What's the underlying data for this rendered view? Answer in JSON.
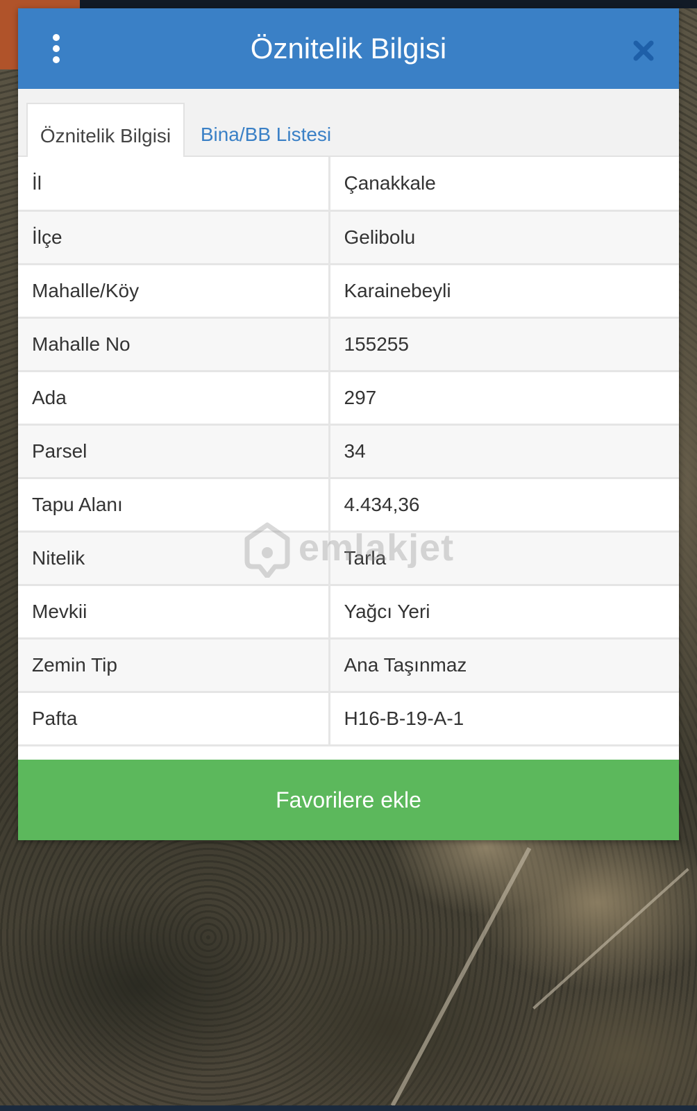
{
  "header": {
    "title": "Öznitelik Bilgisi"
  },
  "tabs": [
    {
      "label": "Öznitelik Bilgisi",
      "active": true
    },
    {
      "label": "Bina/BB Listesi",
      "active": false
    }
  ],
  "attributes": [
    {
      "key": "İl",
      "value": "Çanakkale"
    },
    {
      "key": "İlçe",
      "value": "Gelibolu"
    },
    {
      "key": "Mahalle/Köy",
      "value": "Karainebeyli"
    },
    {
      "key": "Mahalle No",
      "value": "155255"
    },
    {
      "key": "Ada",
      "value": "297"
    },
    {
      "key": "Parsel",
      "value": "34"
    },
    {
      "key": "Tapu Alanı",
      "value": "4.434,36"
    },
    {
      "key": "Nitelik",
      "value": "Tarla"
    },
    {
      "key": "Mevkii",
      "value": "Yağcı Yeri"
    },
    {
      "key": "Zemin Tip",
      "value": "Ana Taşınmaz"
    },
    {
      "key": "Pafta",
      "value": "H16-B-19-A-1"
    }
  ],
  "watermark": {
    "text": "emlakjet"
  },
  "footer": {
    "favorite_label": "Favorilere ekle"
  },
  "colors": {
    "header": "#3a80c6",
    "tab_link": "#3a80c6",
    "favorite_button": "#5cb85c",
    "close_icon": "#1e5fa8"
  },
  "icons": {
    "menu": "vertical-ellipsis-icon",
    "close": "close-icon",
    "watermark_logo": "location-house-icon"
  }
}
